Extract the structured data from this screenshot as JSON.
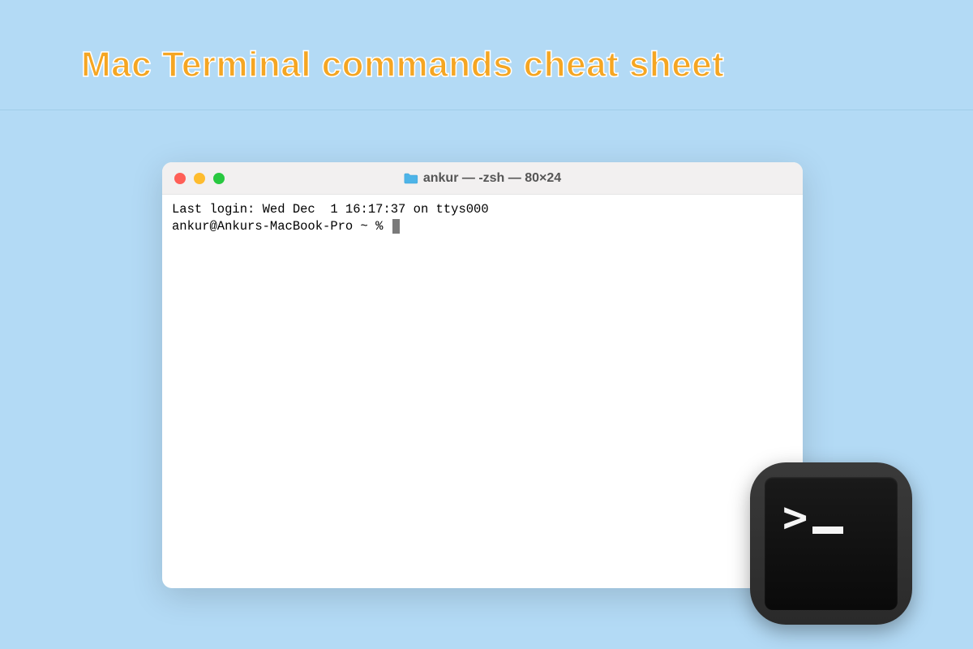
{
  "page": {
    "title": "Mac Terminal commands cheat sheet"
  },
  "terminal": {
    "window_title": "ankur — -zsh — 80×24",
    "last_login_line": "Last login: Wed Dec  1 16:17:37 on ttys000",
    "prompt": "ankur@Ankurs-MacBook-Pro ~ % "
  },
  "app_icon": {
    "prompt_char": ">"
  }
}
